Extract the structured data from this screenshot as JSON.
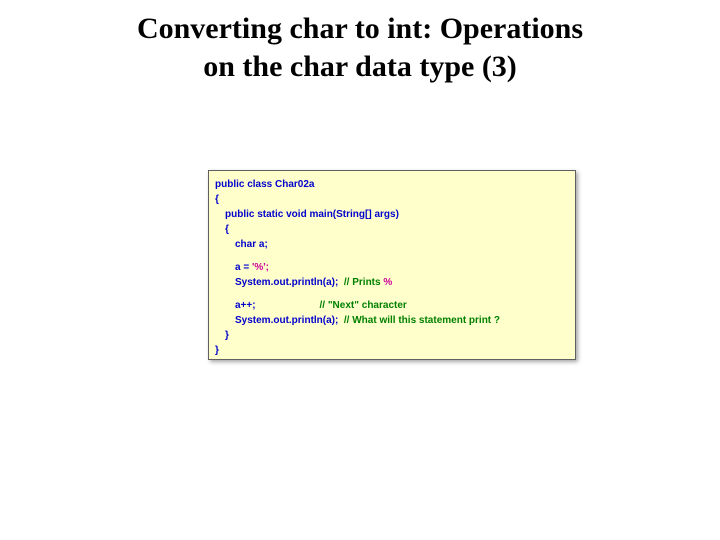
{
  "title_line1": "Converting char to int: Operations",
  "title_line2": "on the char data type (3)",
  "code": {
    "l1": "public class Char02a",
    "l2": "{",
    "l3": "public static void main(String[] args)",
    "l4": "{",
    "l5": "char a;",
    "l6a": "a = ",
    "l6b": "'%';",
    "l7a": "System.out.println(a); ",
    "l7b": " // Prints ",
    "l7c": "%",
    "l8a": "a++;                       ",
    "l8b": "// \"Next\" character",
    "l9a": "System.out.println(a);  ",
    "l9b": "// What will this statement print ?",
    "l10": "}",
    "l11": "}"
  }
}
